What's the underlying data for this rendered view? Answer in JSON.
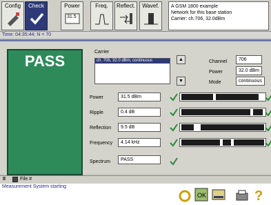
{
  "toolbar": {
    "buttons": [
      {
        "label": "Config",
        "icon": "config-icon",
        "active": false
      },
      {
        "label": "Check",
        "icon": "checkmark-icon",
        "active": true
      },
      {
        "label": "Power",
        "icon": "power-meter-icon",
        "active": false,
        "sub": "31.5"
      },
      {
        "label": "Freq.",
        "icon": "frequency-icon",
        "active": false
      },
      {
        "label": "Reflect.",
        "icon": "reflection-icon",
        "active": false
      },
      {
        "label": "Wavef.",
        "icon": "waveform-icon",
        "active": false
      }
    ],
    "description": "A GSM 1800 example\nNetwork for this base station\nCarrier: ch.706, 32.0dBm"
  },
  "status": {
    "time": "Time: 04:35:44; N = 70"
  },
  "result": {
    "label": "PASS",
    "color": "#2f8a5a"
  },
  "carrier": {
    "title": "Carrier",
    "selected": "ch. 706, 32.0 dBm, continuous",
    "channel_label": "Channel",
    "channel_value": "706",
    "power_label": "Power",
    "power_value": "32.0 dBm",
    "mode_label": "Mode",
    "mode_value": "continuous"
  },
  "measurements": [
    {
      "label": "Power",
      "value": "31.5 dBm",
      "gauge": true
    },
    {
      "label": "Ripple",
      "value": "0.4 dB",
      "gauge": true
    },
    {
      "label": "Reflection",
      "value": "9.5 dB",
      "gauge": true
    },
    {
      "label": "Frequency",
      "value": "4.14 kHz",
      "gauge": true
    },
    {
      "label": "Spectrum",
      "value": "PASS",
      "gauge": false
    }
  ],
  "bottom": {
    "file_label": "File #"
  },
  "message": "Measurement System starting",
  "colors": {
    "accent": "#2e3a78",
    "pass": "#2f8a5a",
    "check": "#2a8a3a"
  }
}
